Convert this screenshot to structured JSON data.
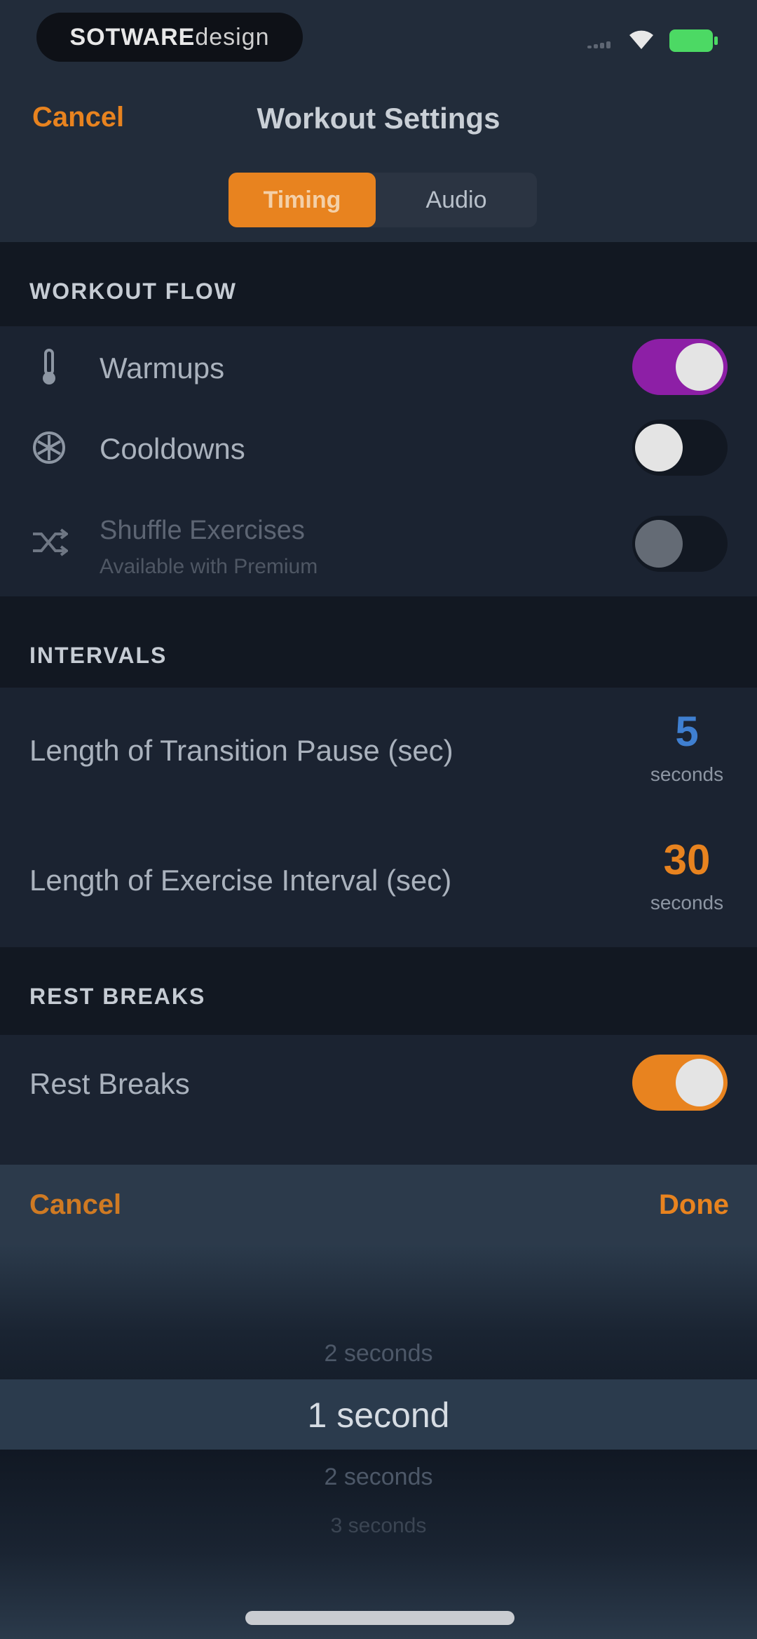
{
  "status_bar": {
    "pill_bold": "SOTWARE",
    "pill_light": "design"
  },
  "nav": {
    "cancel_label": "Cancel",
    "title": "Workout Settings"
  },
  "tabs": [
    {
      "label": "Timing",
      "selected": true
    },
    {
      "label": "Audio",
      "selected": false
    }
  ],
  "sections": {
    "workout_flow": {
      "header": "WORKOUT FLOW",
      "warmup": {
        "label": "Warmups",
        "on": true,
        "icon": "thermometer-icon"
      },
      "cooldown": {
        "label": "Cooldowns",
        "on": false,
        "icon": "snowflake-icon"
      },
      "shuffle": {
        "label": "Shuffle Exercises",
        "sublabel": "Available with Premium",
        "on": false,
        "disabled": true,
        "icon": "shuffle-icon"
      }
    },
    "intervals": {
      "header": "INTERVALS",
      "transition": {
        "label": "Length of Transition Pause (sec)",
        "value": "5",
        "unit": "seconds",
        "color": "#3f7fd0"
      },
      "exercise": {
        "label": "Length of Exercise Interval (sec)",
        "value": "30",
        "unit": "seconds",
        "color": "#e8831f"
      }
    },
    "rest_breaks": {
      "header": "REST BREAKS",
      "rest": {
        "label": "Rest Breaks",
        "on": true
      }
    }
  },
  "picker": {
    "cancel_label": "Cancel",
    "done_label": "Done",
    "items_above": [
      "2 seconds"
    ],
    "selected": "1 second",
    "items_below": [
      "2 seconds",
      "3 seconds"
    ]
  },
  "colors": {
    "accent": "#e8831f",
    "purple_toggle": "#8d1fa6",
    "blue_value": "#3f7fd0"
  }
}
